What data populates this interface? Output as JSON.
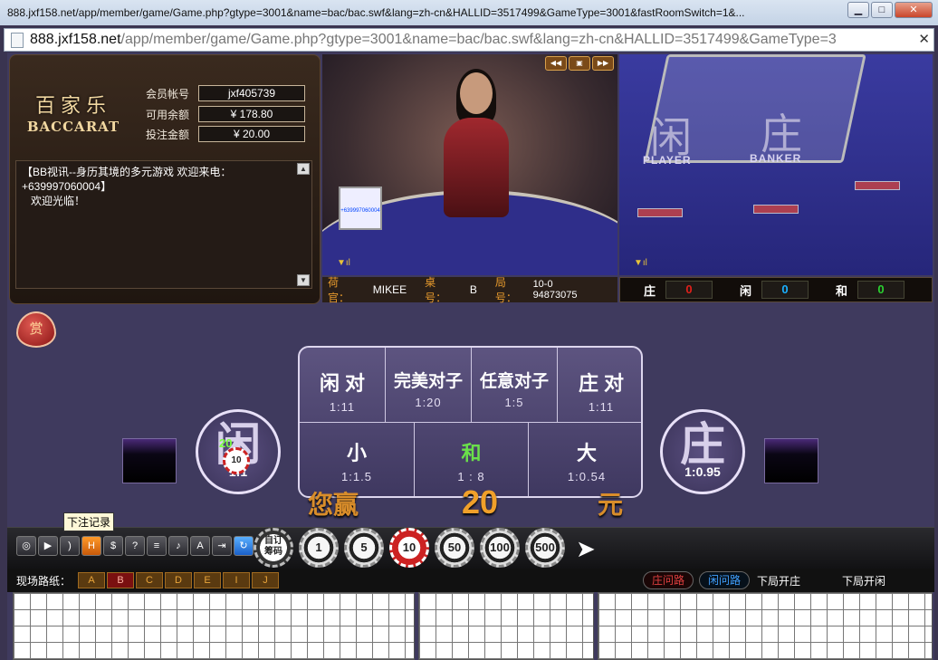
{
  "window": {
    "title": "888.jxf158.net/app/member/game/Game.php?gtype=3001&name=bac/bac.swf&lang=zh-cn&HALLID=3517499&GameType=3001&fastRoomSwitch=1&...",
    "url_host": "888.jxf158.net",
    "url_path": "/app/member/game/Game.php?gtype=3001&name=bac/bac.swf&lang=zh-cn&HALLID=3517499&GameType=3",
    "buttons": {
      "minimize": "▁",
      "maximize": "□",
      "close": "✕"
    }
  },
  "logo": {
    "cn": "百家乐",
    "en": "BACCARAT"
  },
  "account": {
    "member_label": "会员帐号",
    "member_value": "jxf405739",
    "balance_label": "可用余额",
    "balance_value": "¥ 178.80",
    "bet_label": "投注金额",
    "bet_value": "¥ 20.00"
  },
  "notice": {
    "line1": "【BB视讯--身历其境的多元游戏  欢迎来电：",
    "line2": "+639997060004】",
    "line3": "欢迎光临！"
  },
  "video_left": {
    "phone_card": "+639997060004"
  },
  "video_right": {
    "player_word": "闲",
    "player_en": "PLAYER",
    "banker_word": "庄",
    "banker_en": "BANKER"
  },
  "dealer_bar": {
    "dealer_label": "荷官：",
    "dealer_value": "MIKEE",
    "table_label": "桌号：",
    "table_value": "B",
    "round_label": "局号：",
    "round_value": "10-0 94873075"
  },
  "scores": {
    "banker_label": "庄",
    "banker_value": "0",
    "player_label": "闲",
    "player_value": "0",
    "tie_label": "和",
    "tie_value": "0",
    "colors": {
      "banker": "#e0201a",
      "player": "#1ab0ff",
      "tie": "#2ad030"
    }
  },
  "reward_label": "赏",
  "bets": {
    "player_pair": {
      "label": "闲 对",
      "odds": "1:11"
    },
    "perfect_pair": {
      "label": "完美对子",
      "odds": "1:20"
    },
    "either_pair": {
      "label": "任意对子",
      "odds": "1:5"
    },
    "banker_pair": {
      "label": "庄 对",
      "odds": "1:11"
    },
    "small": {
      "label": "小",
      "odds": "1:1.5"
    },
    "tie": {
      "label": "和",
      "odds": "1 : 8"
    },
    "big": {
      "label": "大",
      "odds": "1:0.54"
    },
    "player": {
      "label": "闲",
      "odds": "1:1"
    },
    "banker": {
      "label": "庄",
      "odds": "1:0.95"
    }
  },
  "placed_bet": {
    "amount": "20",
    "chip": "10"
  },
  "win": {
    "label": "您赢",
    "amount": "20",
    "unit": "元"
  },
  "tooltip": "下注记录",
  "toolbar_icons": [
    "chip-stack-icon",
    "video-icon",
    "rss-icon",
    "hd-icon",
    "dollar-icon",
    "help-icon",
    "document-icon",
    "music-icon",
    "font-icon",
    "exit-icon",
    "refresh-icon"
  ],
  "chips": {
    "custom": "自订\n筹码",
    "c1": "1",
    "c5": "5",
    "c10": "10",
    "c50": "50",
    "c100": "100",
    "c500": "500"
  },
  "road": {
    "title": "现场路纸：",
    "tabs": [
      "A",
      "B",
      "C",
      "D",
      "E",
      "I",
      "J"
    ],
    "active_tab": "B",
    "banker_ask": "庄问路",
    "player_ask": "闲问路",
    "next_banker": "下局开庄",
    "next_player": "下局开闲"
  }
}
